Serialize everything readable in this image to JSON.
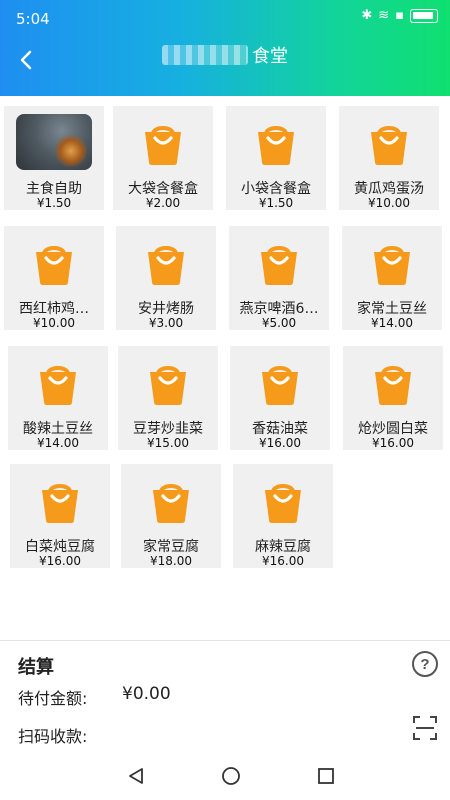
{
  "status": {
    "time": "5:04"
  },
  "header": {
    "title_suffix": "食堂"
  },
  "items": [
    {
      "name": "主食自助",
      "price": "¥1.50",
      "has_photo": true
    },
    {
      "name": "大袋含餐盒",
      "price": "¥2.00"
    },
    {
      "name": "小袋含餐盒",
      "price": "¥1.50"
    },
    {
      "name": "黄瓜鸡蛋汤",
      "price": "¥10.00"
    },
    {
      "name": "西红柿鸡…",
      "price": "¥10.00"
    },
    {
      "name": "安井烤肠",
      "price": "¥3.00"
    },
    {
      "name": "燕京啤酒6…",
      "price": "¥5.00"
    },
    {
      "name": "家常土豆丝",
      "price": "¥14.00"
    },
    {
      "name": "酸辣土豆丝",
      "price": "¥14.00"
    },
    {
      "name": "豆芽炒韭菜",
      "price": "¥15.00"
    },
    {
      "name": "香菇油菜",
      "price": "¥16.00"
    },
    {
      "name": "炝炒圆白菜",
      "price": "¥16.00"
    },
    {
      "name": "白菜炖豆腐",
      "price": "¥16.00"
    },
    {
      "name": "家常豆腐",
      "price": "¥18.00"
    },
    {
      "name": "麻辣豆腐",
      "price": "¥16.00"
    }
  ],
  "checkout": {
    "title": "结算",
    "amount_label": "待付金额:",
    "amount_value": "¥0.00",
    "scan_label": "扫码收款:"
  },
  "icons": {
    "back": "chevron-left-icon",
    "bag": "shopping-bag-icon",
    "help": "question-circle-icon",
    "scan": "scan-frame-icon"
  },
  "colors": {
    "bag": "#f59a1b",
    "header_start": "#1f8ef1",
    "header_end": "#0fe070"
  }
}
